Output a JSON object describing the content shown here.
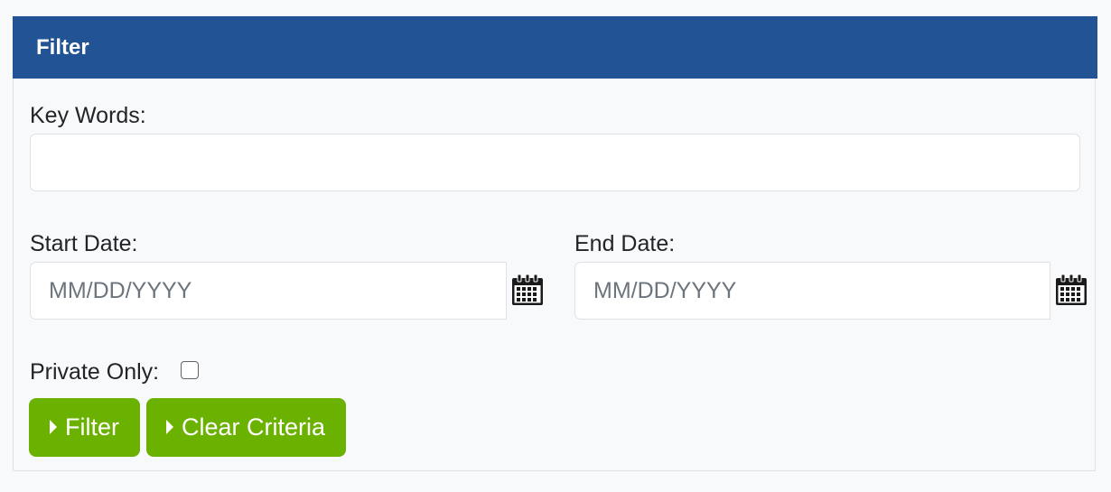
{
  "panel": {
    "title": "Filter",
    "header_color": "#225394"
  },
  "form": {
    "keywords": {
      "label": "Key Words:",
      "value": "",
      "placeholder": ""
    },
    "start_date": {
      "label": "Start Date:",
      "value": "",
      "placeholder": "MM/DD/YYYY",
      "icon": "calendar-icon"
    },
    "end_date": {
      "label": "End Date:",
      "value": "",
      "placeholder": "MM/DD/YYYY",
      "icon": "calendar-icon"
    },
    "private_only": {
      "label": "Private Only:",
      "checked": false
    }
  },
  "buttons": {
    "filter_label": "Filter",
    "clear_label": "Clear Criteria",
    "icon": "caret-right-icon",
    "color": "#6ab100"
  }
}
